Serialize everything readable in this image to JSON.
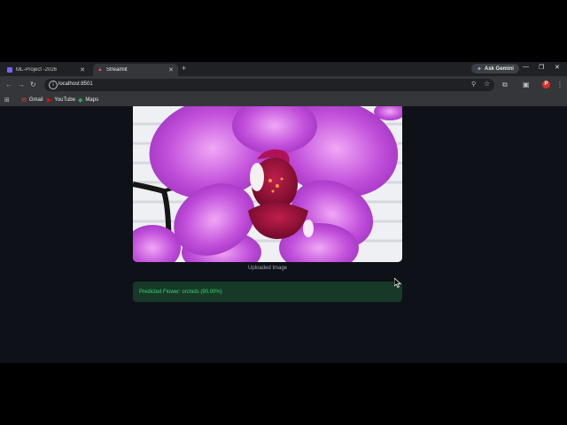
{
  "browser": {
    "tabs": [
      {
        "title": "ML-Project -2026",
        "favicon_color": "#7b61ff",
        "active": false
      },
      {
        "title": "Streamlit",
        "favicon_color": "#ff4b4b",
        "active": true
      }
    ],
    "new_tab_label": "+",
    "gemini_label": "Ask Gemini",
    "address": "localhost:8501",
    "profile_initial": "P",
    "bookmarks": [
      {
        "label": "Gmail",
        "icon": "gmail-icon"
      },
      {
        "label": "YouTube",
        "icon": "youtube-icon"
      },
      {
        "label": "Maps",
        "icon": "maps-icon"
      }
    ]
  },
  "page": {
    "image_caption": "Uploaded Image",
    "prediction_text": "Predicted Flower: orchids (90.00%)"
  },
  "colors": {
    "page_background": "#0e1117",
    "success_background": "#173928",
    "success_text": "#3dd56d",
    "orchid_petal": "#c04fd8"
  }
}
